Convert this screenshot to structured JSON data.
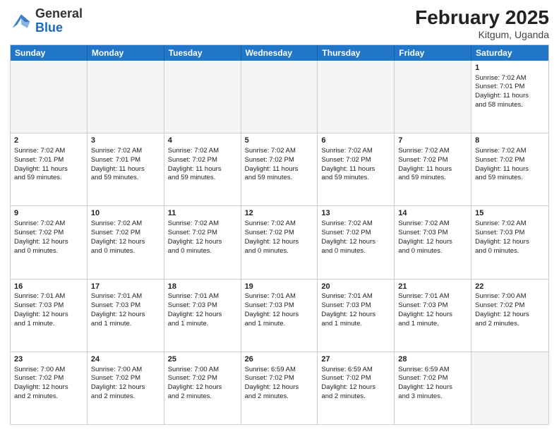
{
  "header": {
    "logo": {
      "general": "General",
      "blue": "Blue"
    },
    "title": "February 2025",
    "location": "Kitgum, Uganda"
  },
  "weekdays": [
    "Sunday",
    "Monday",
    "Tuesday",
    "Wednesday",
    "Thursday",
    "Friday",
    "Saturday"
  ],
  "weeks": [
    [
      {
        "day": "",
        "empty": true
      },
      {
        "day": "",
        "empty": true
      },
      {
        "day": "",
        "empty": true
      },
      {
        "day": "",
        "empty": true
      },
      {
        "day": "",
        "empty": true
      },
      {
        "day": "",
        "empty": true
      },
      {
        "day": "1",
        "lines": [
          "Sunrise: 7:02 AM",
          "Sunset: 7:01 PM",
          "Daylight: 11 hours",
          "and 58 minutes."
        ]
      }
    ],
    [
      {
        "day": "2",
        "lines": [
          "Sunrise: 7:02 AM",
          "Sunset: 7:01 PM",
          "Daylight: 11 hours",
          "and 59 minutes."
        ]
      },
      {
        "day": "3",
        "lines": [
          "Sunrise: 7:02 AM",
          "Sunset: 7:01 PM",
          "Daylight: 11 hours",
          "and 59 minutes."
        ]
      },
      {
        "day": "4",
        "lines": [
          "Sunrise: 7:02 AM",
          "Sunset: 7:02 PM",
          "Daylight: 11 hours",
          "and 59 minutes."
        ]
      },
      {
        "day": "5",
        "lines": [
          "Sunrise: 7:02 AM",
          "Sunset: 7:02 PM",
          "Daylight: 11 hours",
          "and 59 minutes."
        ]
      },
      {
        "day": "6",
        "lines": [
          "Sunrise: 7:02 AM",
          "Sunset: 7:02 PM",
          "Daylight: 11 hours",
          "and 59 minutes."
        ]
      },
      {
        "day": "7",
        "lines": [
          "Sunrise: 7:02 AM",
          "Sunset: 7:02 PM",
          "Daylight: 11 hours",
          "and 59 minutes."
        ]
      },
      {
        "day": "8",
        "lines": [
          "Sunrise: 7:02 AM",
          "Sunset: 7:02 PM",
          "Daylight: 11 hours",
          "and 59 minutes."
        ]
      }
    ],
    [
      {
        "day": "9",
        "lines": [
          "Sunrise: 7:02 AM",
          "Sunset: 7:02 PM",
          "Daylight: 12 hours",
          "and 0 minutes."
        ]
      },
      {
        "day": "10",
        "lines": [
          "Sunrise: 7:02 AM",
          "Sunset: 7:02 PM",
          "Daylight: 12 hours",
          "and 0 minutes."
        ]
      },
      {
        "day": "11",
        "lines": [
          "Sunrise: 7:02 AM",
          "Sunset: 7:02 PM",
          "Daylight: 12 hours",
          "and 0 minutes."
        ]
      },
      {
        "day": "12",
        "lines": [
          "Sunrise: 7:02 AM",
          "Sunset: 7:02 PM",
          "Daylight: 12 hours",
          "and 0 minutes."
        ]
      },
      {
        "day": "13",
        "lines": [
          "Sunrise: 7:02 AM",
          "Sunset: 7:02 PM",
          "Daylight: 12 hours",
          "and 0 minutes."
        ]
      },
      {
        "day": "14",
        "lines": [
          "Sunrise: 7:02 AM",
          "Sunset: 7:03 PM",
          "Daylight: 12 hours",
          "and 0 minutes."
        ]
      },
      {
        "day": "15",
        "lines": [
          "Sunrise: 7:02 AM",
          "Sunset: 7:03 PM",
          "Daylight: 12 hours",
          "and 0 minutes."
        ]
      }
    ],
    [
      {
        "day": "16",
        "lines": [
          "Sunrise: 7:01 AM",
          "Sunset: 7:03 PM",
          "Daylight: 12 hours",
          "and 1 minute."
        ]
      },
      {
        "day": "17",
        "lines": [
          "Sunrise: 7:01 AM",
          "Sunset: 7:03 PM",
          "Daylight: 12 hours",
          "and 1 minute."
        ]
      },
      {
        "day": "18",
        "lines": [
          "Sunrise: 7:01 AM",
          "Sunset: 7:03 PM",
          "Daylight: 12 hours",
          "and 1 minute."
        ]
      },
      {
        "day": "19",
        "lines": [
          "Sunrise: 7:01 AM",
          "Sunset: 7:03 PM",
          "Daylight: 12 hours",
          "and 1 minute."
        ]
      },
      {
        "day": "20",
        "lines": [
          "Sunrise: 7:01 AM",
          "Sunset: 7:03 PM",
          "Daylight: 12 hours",
          "and 1 minute."
        ]
      },
      {
        "day": "21",
        "lines": [
          "Sunrise: 7:01 AM",
          "Sunset: 7:03 PM",
          "Daylight: 12 hours",
          "and 1 minute."
        ]
      },
      {
        "day": "22",
        "lines": [
          "Sunrise: 7:00 AM",
          "Sunset: 7:02 PM",
          "Daylight: 12 hours",
          "and 2 minutes."
        ]
      }
    ],
    [
      {
        "day": "23",
        "lines": [
          "Sunrise: 7:00 AM",
          "Sunset: 7:02 PM",
          "Daylight: 12 hours",
          "and 2 minutes."
        ]
      },
      {
        "day": "24",
        "lines": [
          "Sunrise: 7:00 AM",
          "Sunset: 7:02 PM",
          "Daylight: 12 hours",
          "and 2 minutes."
        ]
      },
      {
        "day": "25",
        "lines": [
          "Sunrise: 7:00 AM",
          "Sunset: 7:02 PM",
          "Daylight: 12 hours",
          "and 2 minutes."
        ]
      },
      {
        "day": "26",
        "lines": [
          "Sunrise: 6:59 AM",
          "Sunset: 7:02 PM",
          "Daylight: 12 hours",
          "and 2 minutes."
        ]
      },
      {
        "day": "27",
        "lines": [
          "Sunrise: 6:59 AM",
          "Sunset: 7:02 PM",
          "Daylight: 12 hours",
          "and 2 minutes."
        ]
      },
      {
        "day": "28",
        "lines": [
          "Sunrise: 6:59 AM",
          "Sunset: 7:02 PM",
          "Daylight: 12 hours",
          "and 3 minutes."
        ]
      },
      {
        "day": "",
        "empty": true
      }
    ]
  ]
}
